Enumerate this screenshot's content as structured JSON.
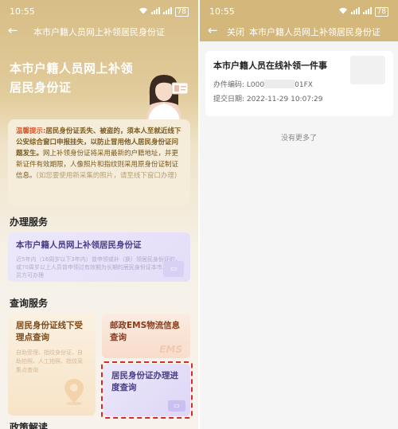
{
  "left": {
    "status": {
      "time": "10:55",
      "battery": "78"
    },
    "nav": {
      "title": "本市户籍人员网上补领居民身份证"
    },
    "hero": {
      "title": "本市户籍人员网上补领居民身份证"
    },
    "notice": {
      "warn_label": "温馨提示:",
      "text_main": "居民身份证丢失、被盗的，须本人至就近线下公安综合窗口申报挂失，以防止冒用他人居民身份证问题发生。",
      "text_rest": "网上补领身份证将采用最新的户籍地址，并更新证件有效期限，人像照片和指纹则采用原身份证制证信息。",
      "text_light": "(如您要使用新采集的照片，请至线下窗口办理)"
    },
    "section_service": "办理服务",
    "service_card": {
      "title": "本市户籍人员网上补领居民身份证",
      "desc": "近5年内（16周岁以下3年内）曾申领或补（换）领居民身份证的，或70周岁以上人员曾申领过有效期为长期的居民身份证本市户籍人员方可办理"
    },
    "section_query": "查询服务",
    "query_cards": [
      {
        "title": "居民身份证线下受理点查询",
        "desc": "自助受理、指纹身份证、自助拍照、人工拍照、指纹采集点查询"
      },
      {
        "title": "邮政EMS物流信息查询",
        "badge": "EMS"
      },
      {
        "title": "居民身份证办理进度查询"
      }
    ],
    "section_policy": "政策解读"
  },
  "right": {
    "status": {
      "time": "10:55",
      "battery": "78"
    },
    "nav": {
      "close": "关闭",
      "title": "本市户籍人员网上补领居民身份证"
    },
    "case": {
      "title": "本市户籍人员在线补领一件事",
      "number_label": "办件编码:",
      "number_prefix": "L000",
      "number_suffix": "01FX",
      "date_label": "提交日期:",
      "date_value": "2022-11-29 10:07:29"
    },
    "no_more": "没有更多了"
  },
  "colors": {
    "gold": "#d4b77b",
    "accent_red": "#d92b2b",
    "purple": "#4a3d88"
  }
}
